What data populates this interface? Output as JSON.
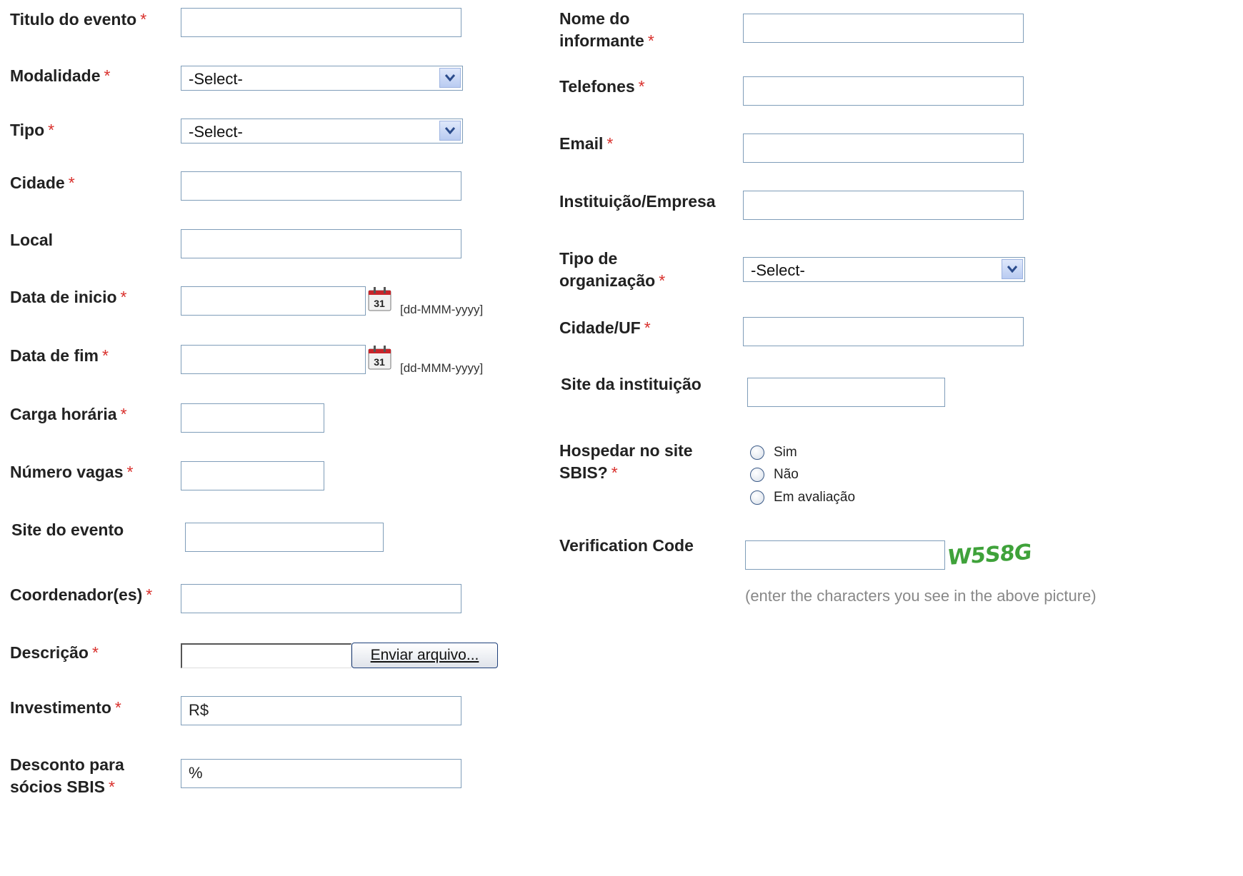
{
  "left_form": {
    "titulo": {
      "label": "Titulo do evento",
      "req": "*"
    },
    "modalidade": {
      "label": "Modalidade",
      "req": "*",
      "value": "-Select-"
    },
    "tipo": {
      "label": "Tipo",
      "req": "*",
      "value": "-Select-"
    },
    "cidade": {
      "label": "Cidade",
      "req": "*"
    },
    "local": {
      "label": "Local"
    },
    "data_inicio": {
      "label": "Data de inicio",
      "req": "*",
      "hint": "[dd-MMM-yyyy]",
      "cal_day": "31"
    },
    "data_fim": {
      "label": "Data de fim",
      "req": "*",
      "hint": "[dd-MMM-yyyy]",
      "cal_day": "31"
    },
    "carga": {
      "label": "Carga horária",
      "req": "*"
    },
    "vagas": {
      "label": "Número vagas",
      "req": "*"
    },
    "site_evento": {
      "label": "Site do evento"
    },
    "coordenador": {
      "label": "Coordenador(es)",
      "req": "*"
    },
    "descricao": {
      "label": "Descrição",
      "req": "*",
      "button": "Enviar arquivo..."
    },
    "investimento": {
      "label": "Investimento",
      "req": "*",
      "value": "R$"
    },
    "desconto": {
      "label_line1": "Desconto para",
      "label_line2": "sócios SBIS",
      "req": "*",
      "value": "%"
    }
  },
  "right_form": {
    "nome": {
      "label_line1": "Nome do",
      "label_line2": "informante",
      "req": "*"
    },
    "telefones": {
      "label": "Telefones",
      "req": "*"
    },
    "email": {
      "label": "Email",
      "req": "*"
    },
    "instituicao": {
      "label": "Instituição/Empresa"
    },
    "tipo_org": {
      "label_line1": "Tipo de",
      "label_line2": "organização",
      "req": "*",
      "value": "-Select-"
    },
    "cidade_uf": {
      "label": "Cidade/UF",
      "req": "*"
    },
    "site_inst": {
      "label": "Site da instituição"
    },
    "hospedar": {
      "label_line1": "Hospedar no site",
      "label_line2": "SBIS?",
      "req": "*",
      "options": [
        "Sim",
        "Não",
        "Em avaliação"
      ]
    },
    "verification": {
      "label": "Verification Code",
      "captcha_text": "W5S8G",
      "note": "(enter the characters you see in the above picture)"
    }
  }
}
